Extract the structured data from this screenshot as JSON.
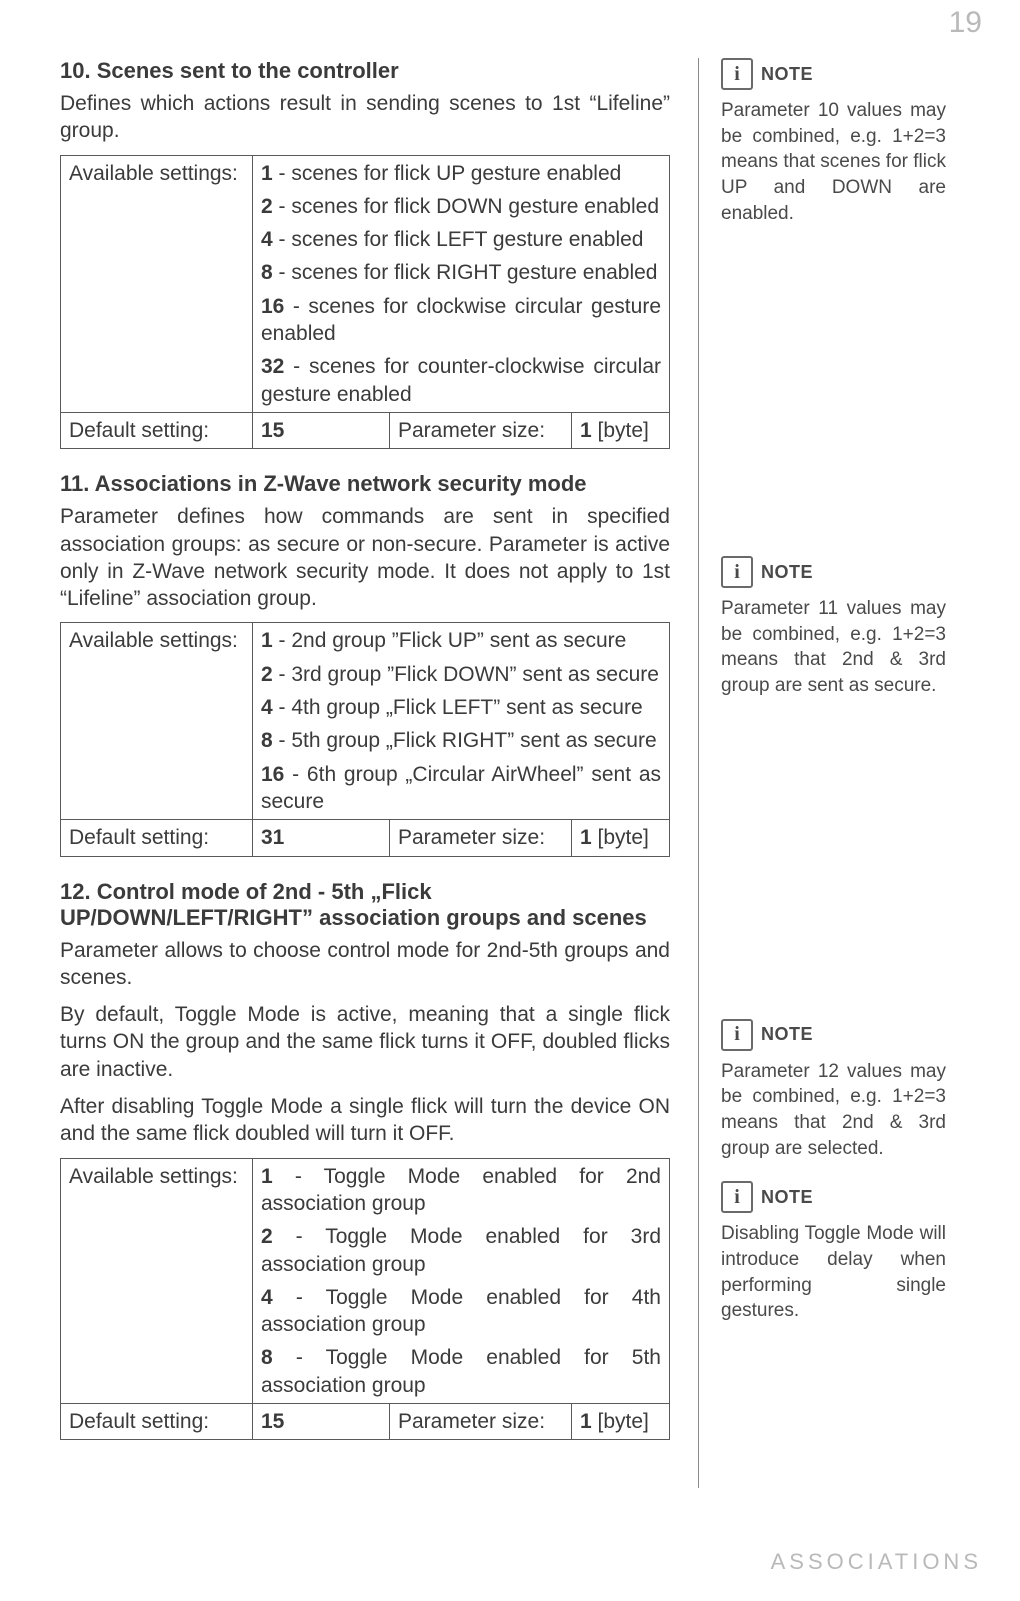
{
  "page_number": "19",
  "footer": "ASSOCIATIONS",
  "labels": {
    "available_settings": "Available settings:",
    "default_setting": "Default setting:",
    "parameter_size": "Parameter size:",
    "note": "NOTE",
    "info_glyph": "i"
  },
  "sections": [
    {
      "title": "10. Scenes sent to the controller",
      "paragraphs": [
        "Defines which actions result in sending scenes to 1st “Lifeline” group."
      ],
      "options": [
        {
          "val": "1",
          "text": " - scenes for flick UP gesture enabled"
        },
        {
          "val": "2",
          "text": " - scenes for flick DOWN gesture enabled"
        },
        {
          "val": "4",
          "text": " - scenes for flick LEFT gesture enabled"
        },
        {
          "val": "8",
          "text": " - scenes for flick RIGHT gesture enabled"
        },
        {
          "val": "16",
          "text": " - scenes for clockwise circular gesture enabled"
        },
        {
          "val": "32",
          "text": " - scenes for counter-clockwise circular gesture enabled"
        }
      ],
      "default": "15",
      "size_val": "1",
      "size_unit": " [byte]"
    },
    {
      "title": "11. Associations in Z-Wave network security mode",
      "paragraphs": [
        "Parameter defines how commands are sent in specified association groups: as secure or non-secure. Parameter is active only in Z-Wave network security mode. It does not apply to 1st “Lifeline” association group."
      ],
      "options": [
        {
          "val": "1",
          "text": " - 2nd group ”Flick UP” sent as secure"
        },
        {
          "val": "2",
          "text": " - 3rd group ”Flick DOWN” sent as secure"
        },
        {
          "val": "4",
          "text": " - 4th group „Flick LEFT” sent as secure"
        },
        {
          "val": "8",
          "text": " - 5th group „Flick RIGHT” sent as secure"
        },
        {
          "val": "16",
          "text": " - 6th group „Circular AirWheel” sent as secure"
        }
      ],
      "default": "31",
      "size_val": "1",
      "size_unit": " [byte]"
    },
    {
      "title": "12. Control mode of 2nd - 5th „Flick UP/DOWN/LEFT/RIGHT” association groups and scenes",
      "paragraphs": [
        "Parameter allows to choose control mode for 2nd-5th groups and scenes.",
        "By default, Toggle Mode is active, meaning that a single flick turns ON the group and the same flick turns it OFF, doubled flicks are inactive.",
        "After disabling Toggle Mode a single flick will turn the device ON and the same flick doubled will turn it OFF."
      ],
      "options": [
        {
          "val": "1",
          "text": " - Toggle Mode enabled for 2nd association group"
        },
        {
          "val": "2",
          "text": " - Toggle Mode enabled for 3rd association group"
        },
        {
          "val": "4",
          "text": " - Toggle Mode enabled for 4th association group"
        },
        {
          "val": "8",
          "text": " - Toggle Mode enabled for 5th association group"
        }
      ],
      "default": "15",
      "size_val": "1",
      "size_unit": " [byte]"
    }
  ],
  "notes": [
    "Parameter 10 values may be combined, e.g. 1+2=3 means that scenes for flick UP and DOWN are enabled.",
    "Parameter 11 values may be combined, e.g. 1+2=3 means that 2nd & 3rd group are sent as secure.",
    "Parameter 12 values may be combined, e.g. 1+2=3 means that 2nd & 3rd group are selected.",
    "Disabling Toggle Mode will introduce delay when performing single gestures."
  ]
}
